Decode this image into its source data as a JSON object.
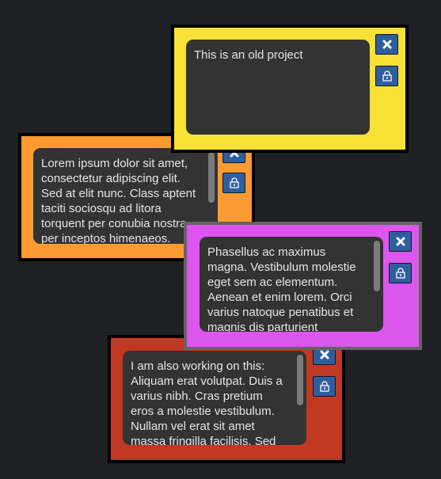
{
  "notes": [
    {
      "id": "orange",
      "text": "Lorem ipsum dolor sit amet, consectetur adipiscing elit. Sed at elit nunc. Class aptent taciti sociosqu ad litora torquent per conubia nostra, per inceptos himenaeos.",
      "color": "#fd9b32",
      "border_color": "#000000",
      "close_icon": "close-icon",
      "lock_icon": "lock-icon"
    },
    {
      "id": "yellow",
      "text": "This is an old project",
      "color": "#f7e235",
      "border_color": "#000000",
      "close_icon": "close-icon",
      "lock_icon": "lock-icon"
    },
    {
      "id": "red",
      "text": "I am also working on this: Aliquam erat volutpat. Duis a varius nibh. Cras pretium eros a molestie vestibulum. Nullam vel erat sit amet massa fringilla facilisis. Sed",
      "color": "#c13823",
      "border_color": "#000000",
      "close_icon": "close-icon",
      "lock_icon": "lock-icon"
    },
    {
      "id": "magenta",
      "text": "Phasellus ac maximus magna. Vestibulum molestie eget sem ac elementum. Aenean et enim lorem. Orci varius natoque penatibus et magnis dis parturient",
      "color": "#dd56ee",
      "border_color": "#646464",
      "close_icon": "close-icon",
      "lock_icon": "lock-icon"
    }
  ]
}
